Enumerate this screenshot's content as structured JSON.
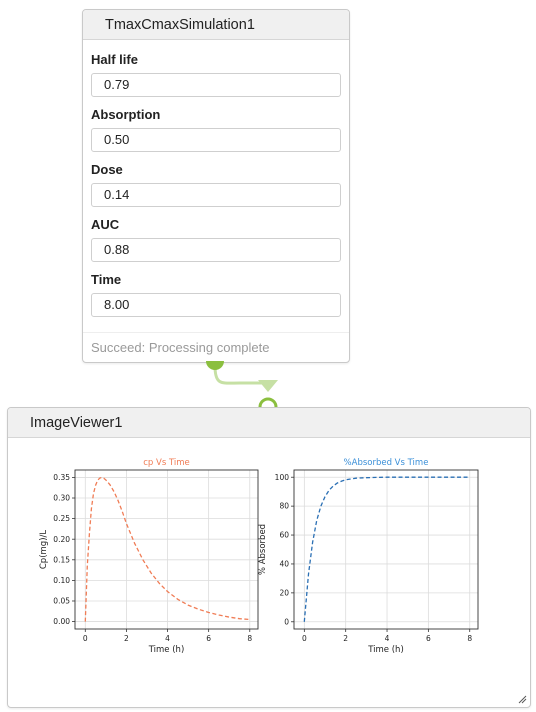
{
  "sim_node": {
    "title": "TmaxCmaxSimulation1",
    "fields": [
      {
        "label": "Half life",
        "value": "0.79"
      },
      {
        "label": "Absorption",
        "value": "0.50"
      },
      {
        "label": "Dose",
        "value": "0.14"
      },
      {
        "label": "AUC",
        "value": "0.88"
      },
      {
        "label": "Time",
        "value": "8.00"
      }
    ],
    "status": "Succeed: Processing complete"
  },
  "viewer_node": {
    "title": "ImageViewer1"
  },
  "colors": {
    "port_out": "#8bbf3f",
    "connector": "#c6e0a4",
    "port_in": "#8bbf3f",
    "cp_line": "#f07c55",
    "abs_line": "#2a6fb4",
    "cp_title": "#f07c55",
    "abs_title": "#3a8fd8"
  },
  "chart_data": [
    {
      "type": "line",
      "title": "cp Vs Time",
      "xlabel": "Time (h)",
      "ylabel": "Cp(mg)/L",
      "xlim": [
        -0.5,
        8.4
      ],
      "ylim": [
        -0.018,
        0.368
      ],
      "xticks": [
        0,
        2,
        4,
        6,
        8
      ],
      "yticks": [
        0.0,
        0.05,
        0.1,
        0.15,
        0.2,
        0.25,
        0.3,
        0.35
      ],
      "ytick_labels": [
        "0.00",
        "0.05",
        "0.10",
        "0.15",
        "0.20",
        "0.25",
        "0.30",
        "0.35"
      ],
      "grid": true,
      "line_style": "dashed",
      "series": [
        {
          "x": [
            0,
            0.1,
            0.2,
            0.3,
            0.4,
            0.5,
            0.6,
            0.7,
            0.8,
            0.9,
            1.0,
            1.2,
            1.4,
            1.6,
            1.8,
            2.0,
            2.4,
            2.8,
            3.2,
            3.6,
            4.0,
            4.5,
            5.0,
            5.5,
            6.0,
            6.5,
            7.0,
            7.5,
            8.0
          ],
          "y": [
            0.0,
            0.136,
            0.213,
            0.274,
            0.311,
            0.331,
            0.343,
            0.348,
            0.35,
            0.348,
            0.344,
            0.332,
            0.315,
            0.293,
            0.267,
            0.238,
            0.19,
            0.15,
            0.118,
            0.093,
            0.073,
            0.054,
            0.04,
            0.03,
            0.022,
            0.016,
            0.011,
            0.007,
            0.005
          ]
        }
      ]
    },
    {
      "type": "line",
      "title": "%Absorbed Vs Time",
      "xlabel": "Time (h)",
      "ylabel": "% Absorbed",
      "xlim": [
        -0.5,
        8.4
      ],
      "ylim": [
        -5,
        105
      ],
      "xticks": [
        0,
        2,
        4,
        6,
        8
      ],
      "yticks": [
        0,
        20,
        40,
        60,
        80,
        100
      ],
      "ytick_labels": [
        "0",
        "20",
        "40",
        "60",
        "80",
        "100"
      ],
      "grid": true,
      "line_style": "dashed",
      "series": [
        {
          "x": [
            0,
            0.2,
            0.4,
            0.6,
            0.8,
            1.0,
            1.2,
            1.4,
            1.6,
            1.8,
            2.0,
            2.5,
            3.0,
            3.5,
            4.0,
            5.0,
            6.0,
            7.0,
            8.0
          ],
          "y": [
            0,
            33,
            55,
            70,
            80,
            86.5,
            91,
            94,
            96,
            97.3,
            98.2,
            99.3,
            99.7,
            99.9,
            100,
            100,
            100,
            100,
            100
          ]
        }
      ]
    }
  ]
}
